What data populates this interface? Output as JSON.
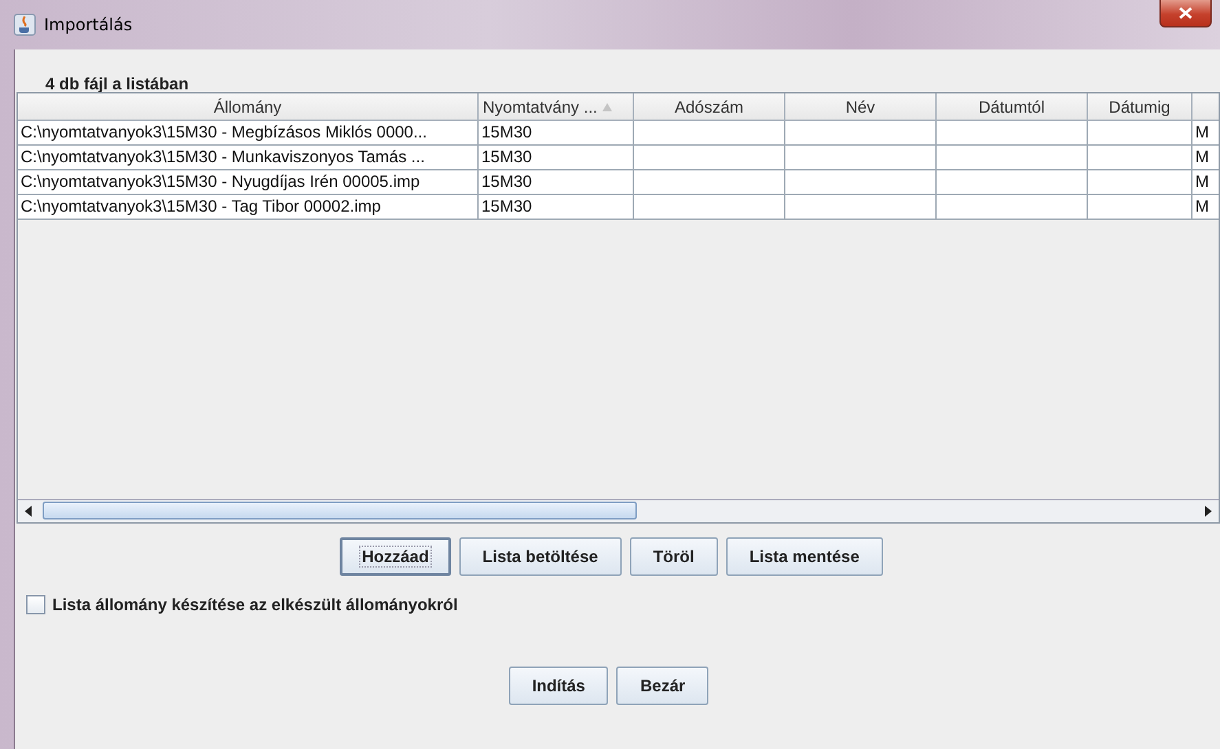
{
  "window": {
    "title": "Importálás"
  },
  "file_count_label": "4 db fájl a listában",
  "table": {
    "columns": [
      {
        "label": "Állomány",
        "sort_indicator": false
      },
      {
        "label": "Nyomtatvány ...",
        "sort_indicator": true
      },
      {
        "label": "Adószám",
        "sort_indicator": false
      },
      {
        "label": "Név",
        "sort_indicator": false
      },
      {
        "label": "Dátumtól",
        "sort_indicator": false
      },
      {
        "label": "Dátumig",
        "sort_indicator": false
      }
    ],
    "rows": [
      {
        "allomany": "C:\\nyomtatvanyok3\\15M30 - Megbízásos Miklós 0000...",
        "nyomtatvany": "15M30",
        "column_7": "M"
      },
      {
        "allomany": "C:\\nyomtatvanyok3\\15M30 - Munkaviszonyos Tamás ...",
        "nyomtatvany": "15M30",
        "column_7": "M"
      },
      {
        "allomany": "C:\\nyomtatvanyok3\\15M30 - Nyugdíjas Irén 00005.imp",
        "nyomtatvany": "15M30",
        "column_7": "M"
      },
      {
        "allomany": "C:\\nyomtatvanyok3\\15M30 - Tag Tibor 00002.imp",
        "nyomtatvany": "15M30",
        "column_7": "M"
      }
    ]
  },
  "list_buttons": [
    {
      "label": "Hozzáad",
      "focused": true
    },
    {
      "label": "Lista betöltése",
      "focused": false
    },
    {
      "label": "Töröl",
      "focused": false
    },
    {
      "label": "Lista mentése",
      "focused": false
    }
  ],
  "checkbox": {
    "label": "Lista állomány készítése az elkészült állományokról",
    "checked": false
  },
  "action_buttons": [
    {
      "label": "Indítás",
      "focused": false
    },
    {
      "label": "Bezár",
      "focused": false
    }
  ]
}
